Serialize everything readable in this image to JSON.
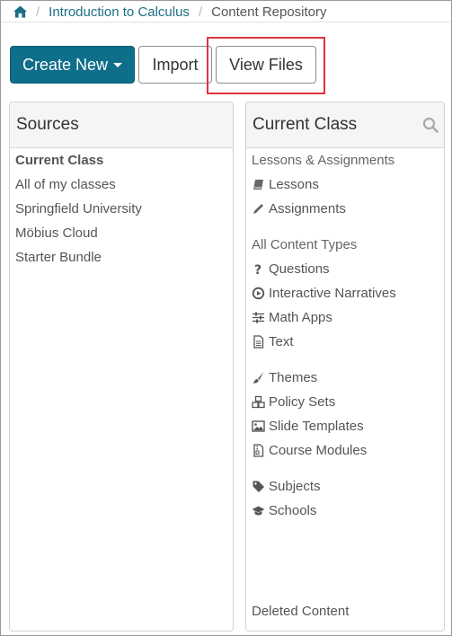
{
  "breadcrumb": {
    "home_icon": "home-icon",
    "items": [
      "Introduction to Calculus",
      "Content Repository"
    ]
  },
  "toolbar": {
    "create_new": "Create New",
    "import": "Import",
    "view_files": "View Files",
    "primary_color": "#0f6e89",
    "highlight_color": "#e0353d"
  },
  "sources": {
    "title": "Sources",
    "items": [
      "Current Class",
      "All of my classes",
      "Springfield University",
      "Möbius Cloud",
      "Starter Bundle"
    ]
  },
  "current_class": {
    "title": "Current Class",
    "search_icon": "search-icon",
    "lessons_section": "Lessons & Assignments",
    "lessons": "Lessons",
    "assignments": "Assignments",
    "content_types_section": "All Content Types",
    "questions": "Questions",
    "interactive_narratives": "Interactive Narratives",
    "math_apps": "Math Apps",
    "text": "Text",
    "themes": "Themes",
    "policy_sets": "Policy Sets",
    "slide_templates": "Slide Templates",
    "course_modules": "Course Modules",
    "subjects": "Subjects",
    "schools": "Schools",
    "deleted_content": "Deleted Content"
  }
}
